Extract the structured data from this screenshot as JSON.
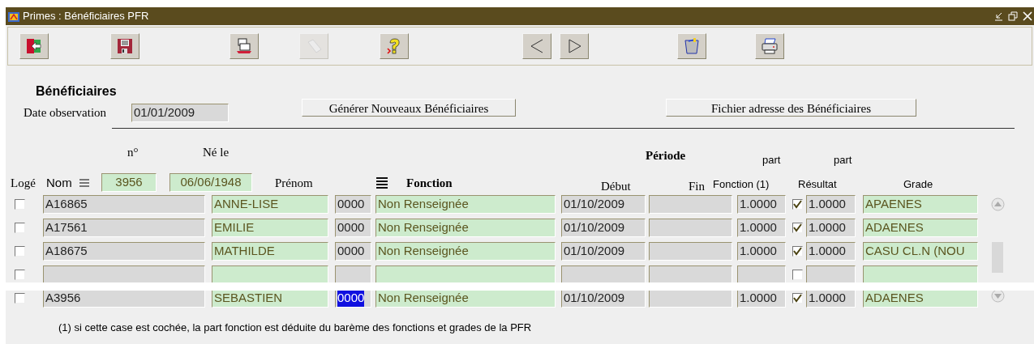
{
  "window": {
    "title": "Primes : Bénéficiaires PFR"
  },
  "toolbar": [
    {
      "kind": "exit",
      "disabled": false
    },
    {
      "kind": "save",
      "disabled": false
    },
    {
      "kind": "print-doc",
      "disabled": false
    },
    {
      "kind": "eraser",
      "disabled": true
    },
    {
      "kind": "help",
      "disabled": false
    },
    {
      "kind": "prev",
      "disabled": false
    },
    {
      "kind": "next",
      "disabled": false
    },
    {
      "kind": "bin",
      "disabled": false
    },
    {
      "kind": "printer",
      "disabled": false
    }
  ],
  "section_title": "Bénéficiaires",
  "date_observation": {
    "label": "Date observation",
    "value": "01/01/2009"
  },
  "buttons": [
    "Générer Nouveaux Bénéficiaires",
    "Fichier adresse des Bénéficiaires"
  ],
  "headers": {
    "numero": "n°",
    "ne_le": "Né le",
    "loge": "Logé",
    "nom": "Nom",
    "prenom": "Prénom",
    "fonction": "Fonction",
    "periode": "Période",
    "debut": "Début",
    "fin": "Fin",
    "part1": "part",
    "part_fonction": "Fonction (1)",
    "part2": "part",
    "part_resultat": "Résultat",
    "grade": "Grade"
  },
  "query": {
    "numero": "3956",
    "ne_le": "06/06/1948"
  },
  "rows": [
    {
      "kind": "full",
      "loge": false,
      "nom": "A16865",
      "prenom": "ANNE-LISE",
      "code": "0000",
      "code_selected": false,
      "fonction": "Non Renseignée",
      "debut": "01/10/2009",
      "part_fonction": "1.0000",
      "deduite": true,
      "part_resultat": "1.0000",
      "grade": "APAENES"
    },
    {
      "kind": "full",
      "loge": false,
      "nom": "A17561",
      "prenom": "EMILIE",
      "code": "0000",
      "code_selected": false,
      "fonction": "Non Renseignée",
      "debut": "01/10/2009",
      "part_fonction": "1.0000",
      "deduite": true,
      "part_resultat": "1.0000",
      "grade": "ADAENES"
    },
    {
      "kind": "full",
      "loge": false,
      "nom": "A18675",
      "prenom": "MATHILDE",
      "code": "0000",
      "code_selected": false,
      "fonction": "Non Renseignée",
      "debut": "01/10/2009",
      "part_fonction": "1.0000",
      "deduite": true,
      "part_resultat": "1.0000",
      "grade": "CASU CL.N (NOU"
    },
    {
      "kind": "hidden",
      "loge": false,
      "deduite": false
    },
    {
      "kind": "full",
      "loge": false,
      "nom": "A3956",
      "prenom": "SEBASTIEN",
      "code": "0000",
      "code_selected": true,
      "fonction": "Non Renseignée",
      "debut": "01/10/2009",
      "part_fonction": "1.0000",
      "deduite": true,
      "part_resultat": "1.0000",
      "grade": "ADAENES"
    }
  ],
  "footnote": "(1) si cette case est cochée, la part fonction est déduite du barème des fonctions et grades de la PFR"
}
